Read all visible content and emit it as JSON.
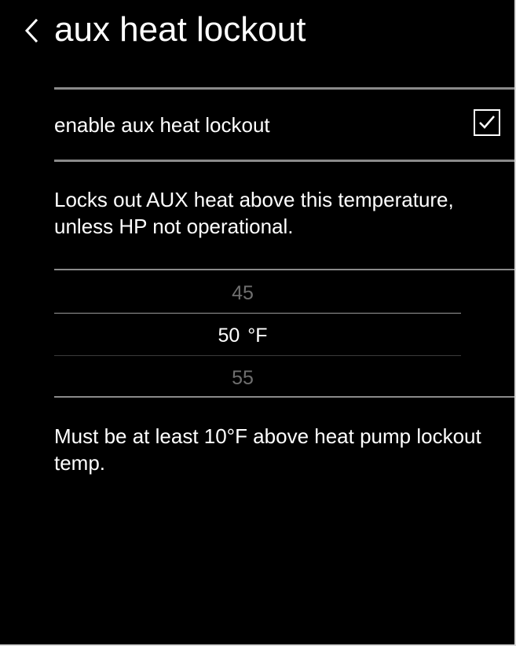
{
  "header": {
    "title": "aux heat lockout",
    "back_icon": "chevron-left-icon"
  },
  "toggle": {
    "label": "enable aux heat lockout",
    "checked": true,
    "icon": "checkbox-checked-icon"
  },
  "description": "Locks out AUX heat above this temperature, unless HP not operational.",
  "picker": {
    "options": [
      "45",
      "50",
      "55"
    ],
    "selected_value": "50",
    "unit": "°F"
  },
  "note": "Must be at least 10°F above heat pump lockout temp.",
  "colors": {
    "background": "#000000",
    "text": "#ffffff",
    "dim_text": "#6f6f6f",
    "divider": "#8a8a8a"
  }
}
